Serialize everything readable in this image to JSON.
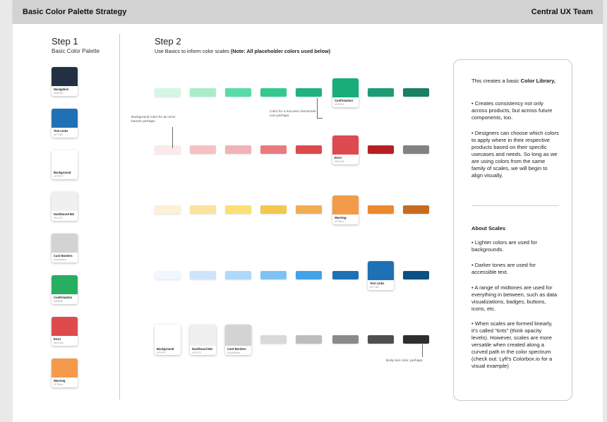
{
  "header": {
    "title": "Basic Color Palette Strategy",
    "team": "Central UX Team"
  },
  "step1": {
    "title": "Step 1",
    "subtitle": "Basic Color Palette",
    "cards": [
      {
        "label": "Navigation",
        "sub": "#2B2E4B",
        "color": "#233043"
      },
      {
        "label": "Text Links",
        "sub": "#1F71B0",
        "color": "#1f71b5"
      },
      {
        "label": "Background",
        "sub": "#FFFFFF",
        "color": "#ffffff"
      },
      {
        "label": "Dashboard BG",
        "sub": "#F1F2F2",
        "color": "#f0f0f0"
      },
      {
        "label": "Card Borders",
        "sub": "Dropshadow",
        "color": "#d3d3d3"
      },
      {
        "label": "Confirmation",
        "sub": "#3BB35E",
        "color": "#27ae60"
      },
      {
        "label": "Error",
        "sub": "#DC4448",
        "color": "#dd4b4c"
      },
      {
        "label": "Warning",
        "sub": "#F7984A",
        "color": "#f49a4a"
      }
    ]
  },
  "step2": {
    "title": "Step 2",
    "subtitle_plain": "Use Basics to inform color scales ",
    "subtitle_bold": "(Note: All placeholder colors used below)",
    "rows": [
      {
        "chips": [
          "#d3f7e2",
          "#a9ecc9",
          "#59dba8",
          "#32c98c",
          "#1fb180"
        ],
        "card": {
          "label": "Confirmation",
          "sub": "#1EB37A",
          "color": "#17ae7a"
        },
        "after": [
          "#1c9c74",
          "#198062"
        ]
      },
      {
        "chips": [
          "#fde9e9",
          "#f5c1c3",
          "#f1b3b6",
          "#e87b7e",
          "#dd4a4d"
        ],
        "card": {
          "label": "Error",
          "sub": "#DC4448",
          "color": "#dd4a4f"
        },
        "after": [
          "#b61f24",
          "#828282"
        ]
      },
      {
        "chips": [
          "#fdf0d8",
          "#fbe39b",
          "#fbe074",
          "#f3c84c",
          "#f2ad52"
        ],
        "card": {
          "label": "Warning",
          "sub": "#F7984A",
          "color": "#f49b4a"
        },
        "after": [
          "#ec8a2f",
          "#c66c20"
        ]
      },
      {
        "chips": [
          "#f0f7ff",
          "#cde4fb",
          "#addafb",
          "#7ec2f4",
          "#43a1e8",
          "#1f71b5"
        ],
        "card": {
          "label": "Text Links",
          "sub": "#1F71B0",
          "color": "#1f71b5"
        },
        "after": [
          "#0b5082"
        ]
      }
    ],
    "gray_cards": [
      {
        "label": "Background",
        "sub": "#FFFFFF",
        "color": "#ffffff"
      },
      {
        "label": "Dashboard BG",
        "sub": "#F1F2F2",
        "color": "#f0f0f0"
      },
      {
        "label": "Card Borders",
        "sub": "Dropshadow",
        "color": "#d3d3d3"
      }
    ],
    "gray_chips": [
      "#d9d9d9",
      "#bdbdbd",
      "#8a8a8a",
      "#4f4f4f",
      "#2e2e2e"
    ],
    "notes": {
      "bg": "Background color for an error banner perhaps",
      "success": "Color for a success checkmark icon perhaps",
      "body": "Body text color, perhaps"
    }
  },
  "panel": {
    "intro_plain": "This creates a basic ",
    "intro_bold": "Color Library,",
    "bullet1": "• Creates consistency not only across products, but across future components, too.",
    "bullet2": "• Designers can choose which colors to apply where in their respective products based on their specific usecases and needs. So long as we are using colors from the same family of scales, we will begin to align visually.",
    "about_title": "About Scales",
    "about1": "• Lighter colors are used for backgrounds.",
    "about2": "• Darker tones are used for accessible text.",
    "about3": "• A range of midtones are used for everything in between, such as data visualizations, badges, buttons, icons, etc.",
    "about4": "• When scales are formed linearly, it's called \"tints\" (think opacity levels). However, scales are more versatile when created along a curved path in the color spectrum (check out: Lyft's Colorbox.io for a visual example)"
  }
}
